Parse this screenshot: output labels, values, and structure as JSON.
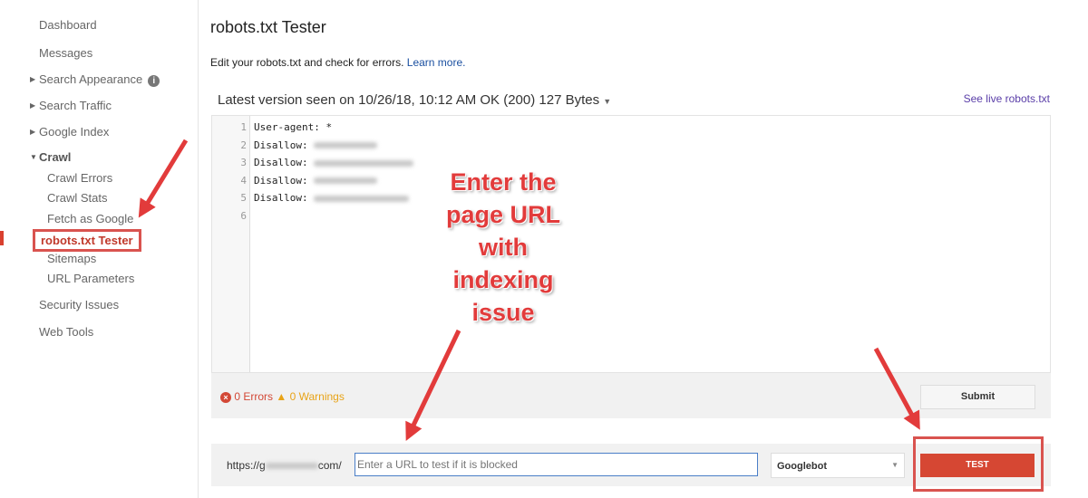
{
  "sidebar": {
    "items": [
      {
        "label": "Dashboard"
      },
      {
        "label": "Messages"
      },
      {
        "label": "Search Appearance"
      },
      {
        "label": "Search Traffic"
      },
      {
        "label": "Google Index"
      },
      {
        "label": "Crawl"
      },
      {
        "label": "Crawl Errors"
      },
      {
        "label": "Crawl Stats"
      },
      {
        "label": "Fetch as Google"
      },
      {
        "label": "robots.txt Tester"
      },
      {
        "label": "Sitemaps"
      },
      {
        "label": "URL Parameters"
      },
      {
        "label": "Security Issues"
      },
      {
        "label": "Web Tools"
      }
    ]
  },
  "main": {
    "title": "robots.txt Tester",
    "description": "Edit your robots.txt and check for errors.",
    "learn_more": "Learn more.",
    "version": "Latest version seen on 10/26/18, 10:12 AM OK (200) 127 Bytes",
    "see_live": "See live robots.txt",
    "editor_lines": [
      {
        "n": "1",
        "text": "User-agent: *"
      },
      {
        "n": "2",
        "text": "Disallow: "
      },
      {
        "n": "3",
        "text": "Disallow: "
      },
      {
        "n": "4",
        "text": "Disallow: "
      },
      {
        "n": "5",
        "text": "Disallow: "
      },
      {
        "n": "6",
        "text": ""
      }
    ],
    "errors": "0 Errors",
    "warnings": "0 Warnings",
    "submit": "Submit",
    "url_prefix_start": "https://g",
    "url_prefix_end": "com/",
    "url_placeholder": "Enter a URL to test if it is blocked",
    "user_agent": "Googlebot",
    "test": "TEST"
  },
  "annotation": {
    "callout_lines": [
      "Enter the",
      "page URL",
      "with",
      "indexing",
      "issue"
    ],
    "color": "#e23b3b"
  }
}
